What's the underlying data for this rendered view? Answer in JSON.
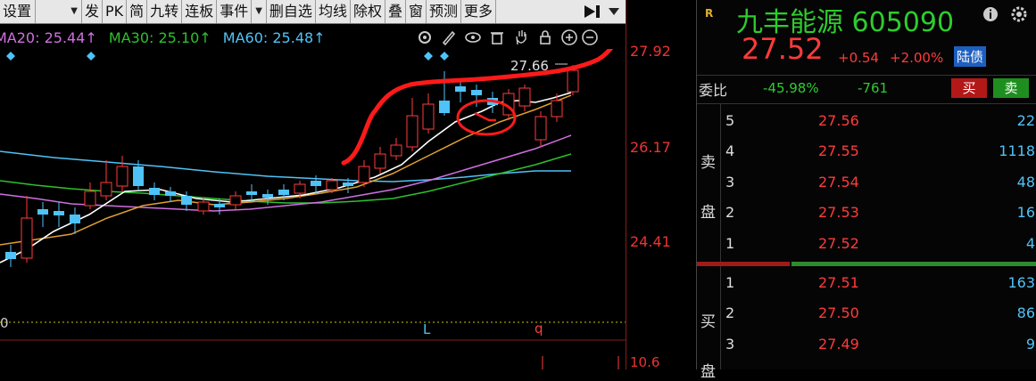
{
  "toolbar": {
    "items": [
      "设置",
      "发",
      "PK",
      "简",
      "九转",
      "连板",
      "事件",
      "删自选",
      "均线",
      "除权",
      "叠",
      "窗",
      "预测",
      "更多"
    ]
  },
  "ma": {
    "ma20": "MA20: 25.44↑",
    "ma30": "MA30: 25.10↑",
    "ma60": "MA60: 25.48↑"
  },
  "chart": {
    "high_label": "27.66",
    "marker_l": "L",
    "marker_q": "q",
    "zero_label": "0"
  },
  "price_axis": {
    "labels": [
      "27.92",
      "26.17",
      "24.41",
      "10.6"
    ]
  },
  "stock": {
    "name_code": "九丰能源 605090",
    "price": "27.52",
    "change": "+0.54",
    "change_pct": "+2.00%",
    "badge": "陆债",
    "r_badge": "R"
  },
  "ratio": {
    "label": "委比",
    "pct": "-45.98%",
    "diff": "-761",
    "buy": "买",
    "sell": "卖"
  },
  "order_book": {
    "sell_label_1": "卖",
    "sell_label_2": "盘",
    "buy_label_1": "买",
    "buy_label_2": "盘",
    "asks": [
      {
        "level": "5",
        "price": "27.56",
        "vol": "22"
      },
      {
        "level": "4",
        "price": "27.55",
        "vol": "1118"
      },
      {
        "level": "3",
        "price": "27.54",
        "vol": "48"
      },
      {
        "level": "2",
        "price": "27.53",
        "vol": "16"
      },
      {
        "level": "1",
        "price": "27.52",
        "vol": "4"
      }
    ],
    "bids": [
      {
        "level": "1",
        "price": "27.51",
        "vol": "163"
      },
      {
        "level": "2",
        "price": "27.50",
        "vol": "86"
      },
      {
        "level": "3",
        "price": "27.49",
        "vol": "9"
      }
    ]
  },
  "colors": {
    "up": "#ff3b3b",
    "down": "#2ecc2e",
    "ma5": "#ffffff",
    "ma10": "#e0a030",
    "ma20": "#d070e0",
    "ma30": "#2ec12e",
    "ma60": "#4fc3f7"
  }
}
